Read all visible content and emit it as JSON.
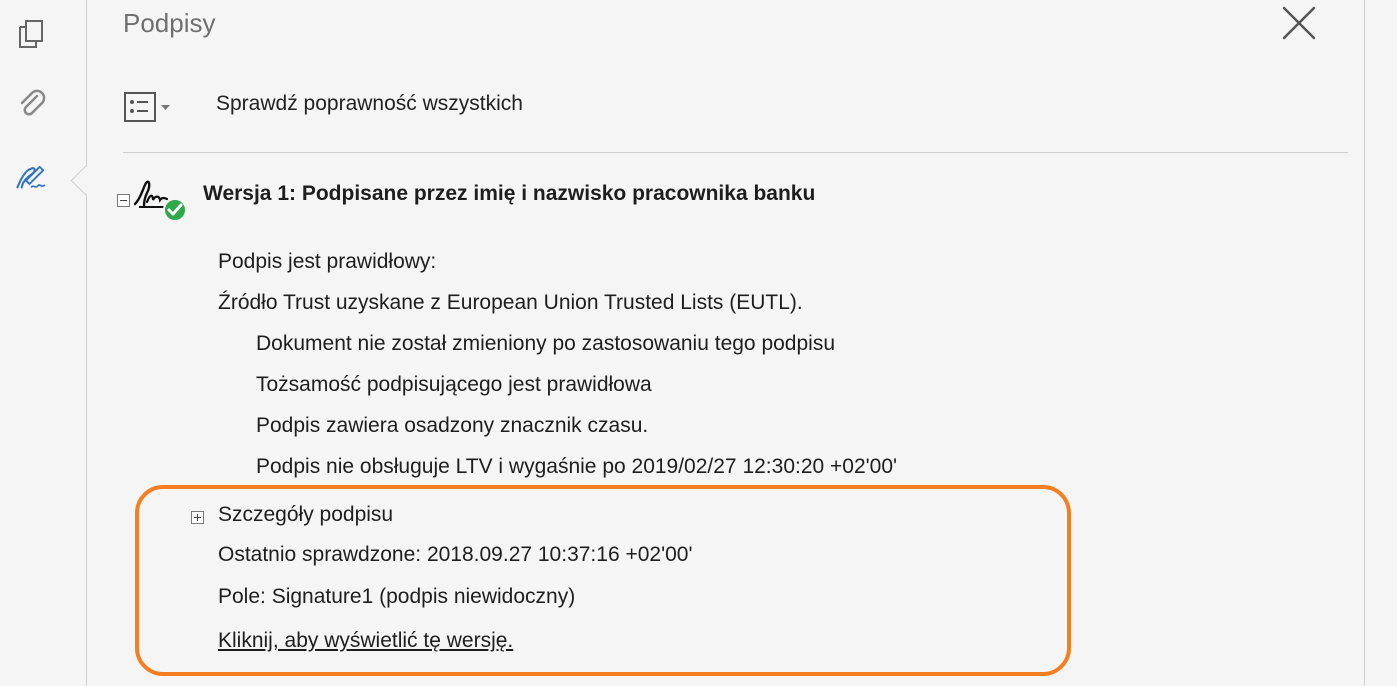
{
  "panel": {
    "title": "Podpisy"
  },
  "toolbar": {
    "validate_all_label": "Sprawdź poprawność wszystkich"
  },
  "version": {
    "title": "Wersja 1: Podpisane przez  imię i nazwisko pracownika banku",
    "status": "Podpis jest prawidłowy:",
    "trust_source": "Źródło Trust uzyskane z European Union Trusted Lists (EUTL).",
    "checks": [
      "Dokument nie został zmieniony po zastosowaniu tego podpisu",
      "Tożsamość podpisującego jest prawidłowa",
      "Podpis zawiera osadzony znacznik czasu.",
      "Podpis nie obsługuje LTV i wygaśnie po 2019/02/27 12:30:20 +02'00'"
    ],
    "details_label": "Szczegóły podpisu",
    "last_checked": "Ostatnio sprawdzone: 2018.09.27 10:37:16 +02'00'",
    "field": "Pole: Signature1 (podpis niewidoczny)",
    "view_link": "Kliknij, aby wyświetlić tę wersję."
  },
  "icons": {
    "rail": [
      "pages-icon",
      "attachment-icon",
      "signature-pen-icon"
    ],
    "close": "close-icon",
    "options": "options-list-icon",
    "signature_status": "signature-valid-icon"
  },
  "colors": {
    "highlight": "#f57f20",
    "signature_blue": "#2f74c0",
    "valid_green": "#2ea84a"
  }
}
